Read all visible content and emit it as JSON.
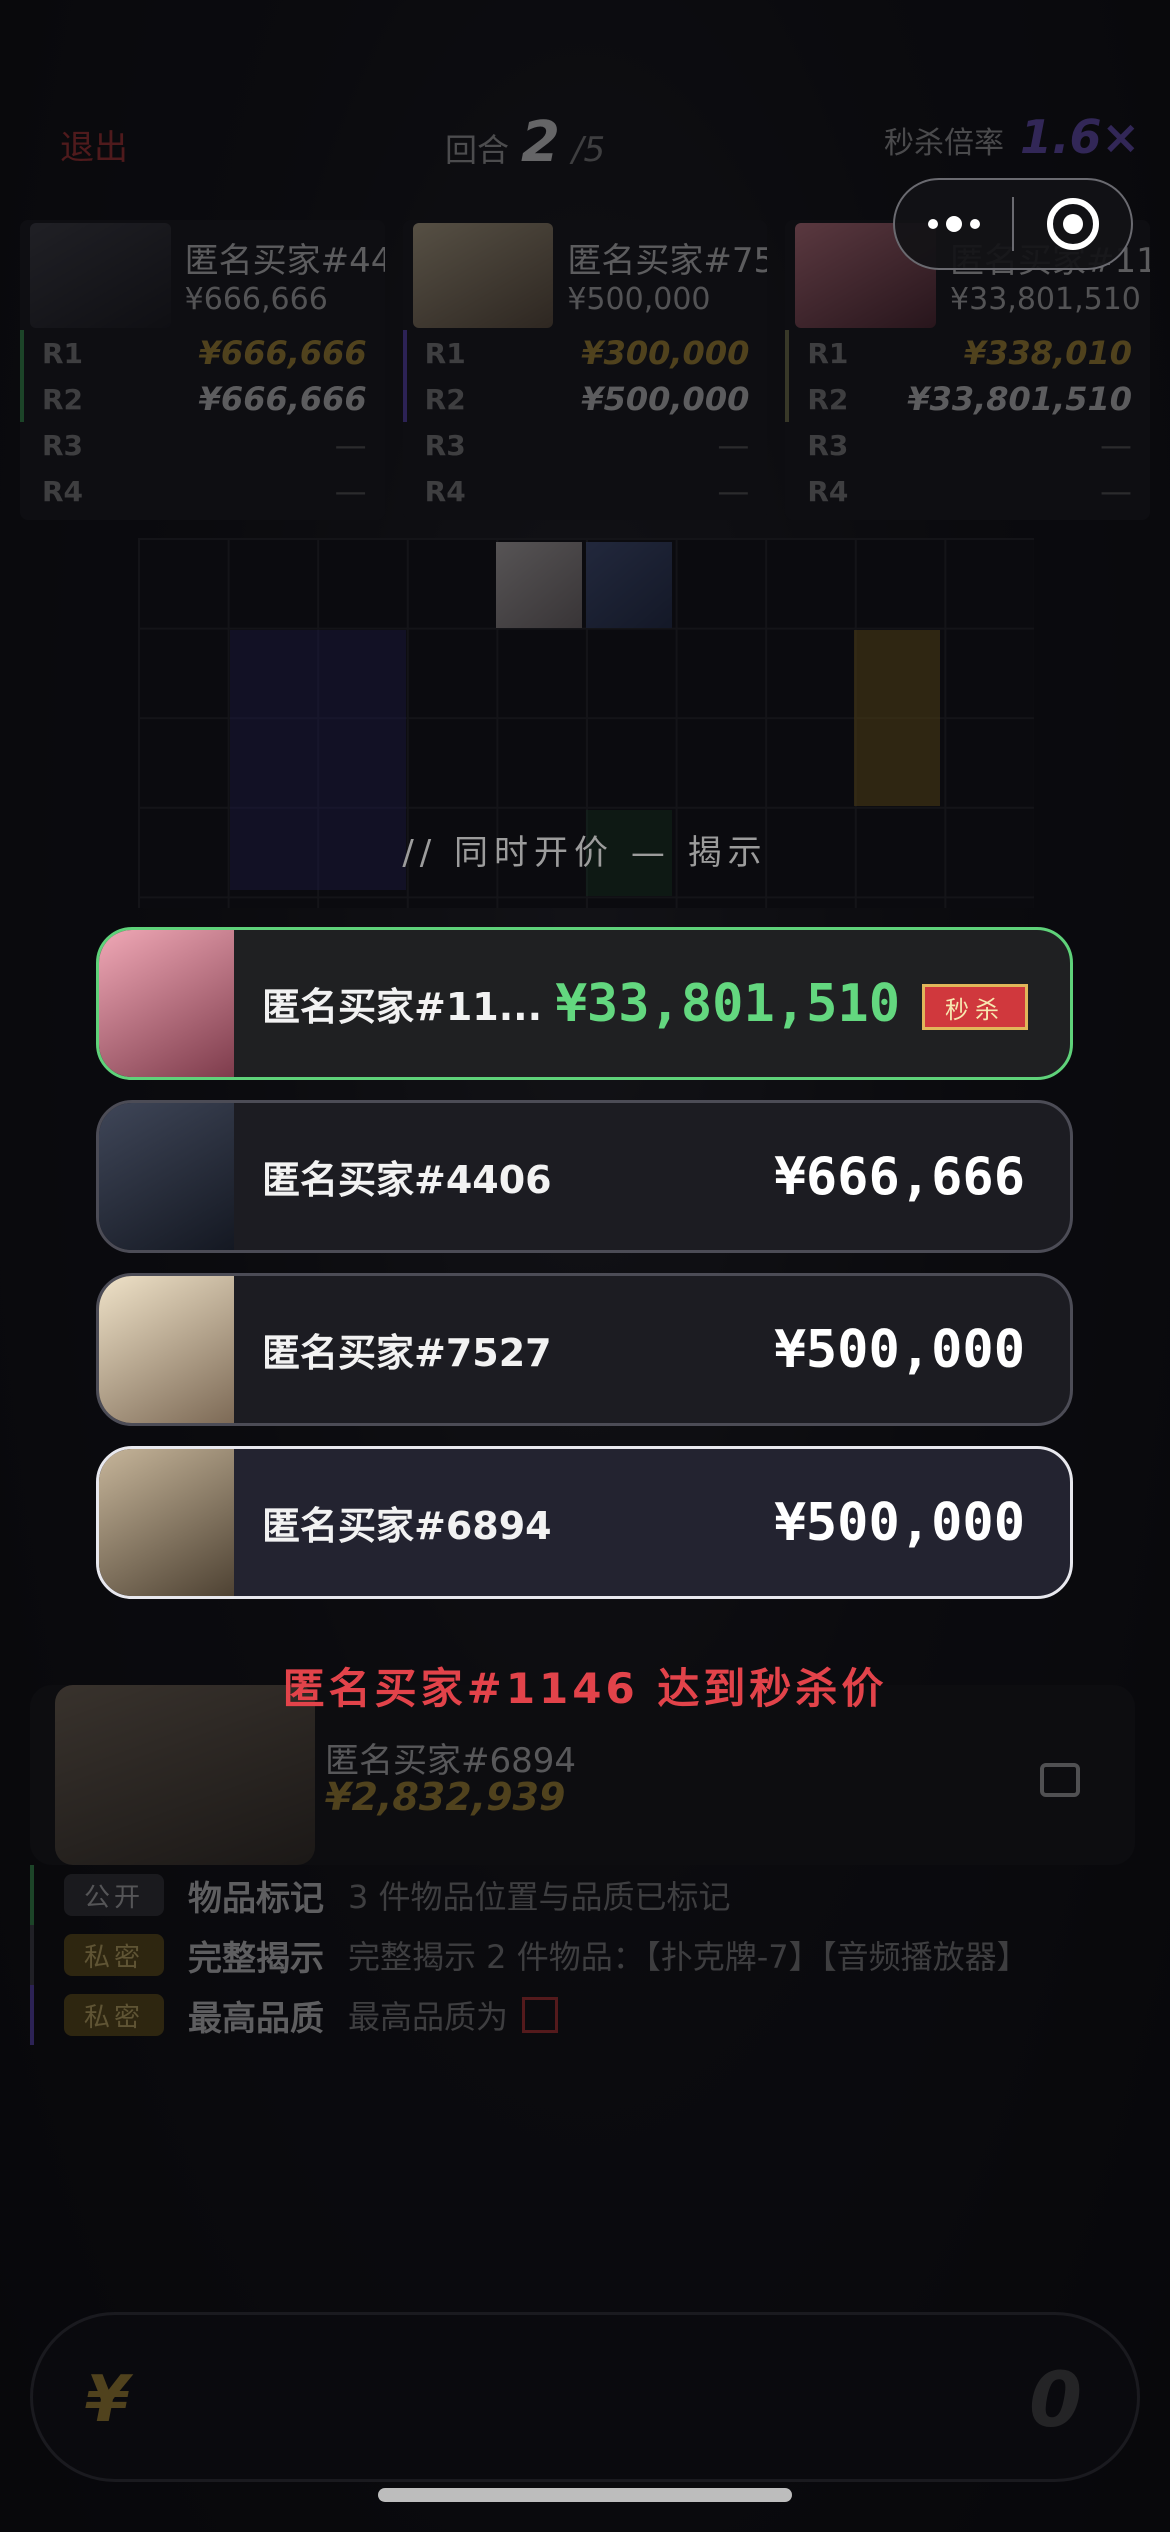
{
  "header": {
    "exit_label": "退出",
    "round_label": "回合",
    "round_current": "2",
    "round_total": "/5",
    "multiplier_label": "秒杀倍率",
    "multiplier_value": "1.6×"
  },
  "players": [
    {
      "name": "匿名买家#4406",
      "amount": "¥666,666",
      "rounds": [
        {
          "label": "R1",
          "value": "¥666,666"
        },
        {
          "label": "R2",
          "value": "¥666,666"
        },
        {
          "label": "R3",
          "value": "—"
        },
        {
          "label": "R4",
          "value": "—"
        }
      ]
    },
    {
      "name": "匿名买家#7527",
      "amount": "¥500,000",
      "rounds": [
        {
          "label": "R1",
          "value": "¥300,000"
        },
        {
          "label": "R2",
          "value": "¥500,000"
        },
        {
          "label": "R3",
          "value": "—"
        },
        {
          "label": "R4",
          "value": "—"
        }
      ]
    },
    {
      "name": "匿名买家#1146",
      "amount": "¥33,801,510",
      "rounds": [
        {
          "label": "R1",
          "value": "¥338,010"
        },
        {
          "label": "R2",
          "value": "¥33,801,510"
        },
        {
          "label": "R3",
          "value": "—"
        },
        {
          "label": "R4",
          "value": "—"
        }
      ]
    }
  ],
  "grid": {
    "caption": "// 同时开价 — 揭示"
  },
  "bids": [
    {
      "name": "匿名买家#11...",
      "amount": "¥33,801,510",
      "badge": "秒杀"
    },
    {
      "name": "匿名买家#4406",
      "amount": "¥666,666"
    },
    {
      "name": "匿名买家#7527",
      "amount": "¥500,000"
    },
    {
      "name": "匿名买家#6894",
      "amount": "¥500,000"
    }
  ],
  "notice": "匿名买家#1146 达到秒杀价",
  "self": {
    "name": "匿名买家#6894",
    "amount": "¥2,832,939"
  },
  "hints": [
    {
      "tag": "公开",
      "title": "物品标记",
      "desc": "3 件物品位置与品质已标记"
    },
    {
      "tag": "私密",
      "title": "完整揭示",
      "desc": "完整揭示 2 件物品：【扑克牌-7】【音频播放器】"
    },
    {
      "tag": "私密",
      "title": "最高品质",
      "desc": "最高品质为"
    }
  ],
  "input": {
    "currency": "¥",
    "value": "0"
  },
  "colors": {
    "win": "#63d77f",
    "alert": "#e2434a",
    "gold": "#c9a43d",
    "multiplier": "#7a5cd6"
  },
  "icons": {
    "more": "more-dots-icon",
    "close": "target-close-icon",
    "chat": "chat-bubble-icon"
  }
}
